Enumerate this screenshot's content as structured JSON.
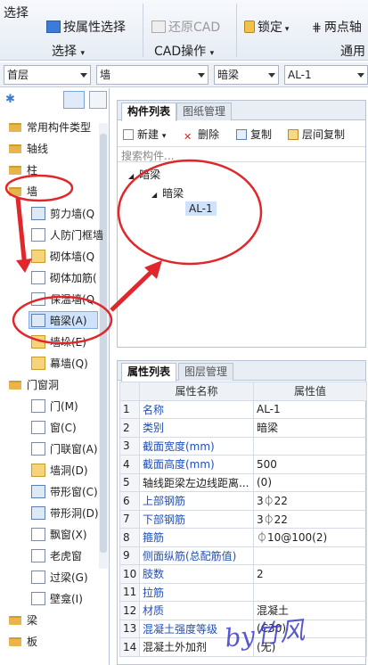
{
  "ribbon": {
    "select_label": "选择",
    "select_by_property": "按属性选择",
    "restore_cad": "还原CAD",
    "lock": "锁定",
    "two_point": "两点轴",
    "group_select": "选择",
    "group_cad": "CAD操作",
    "group_general": "通用"
  },
  "filters": {
    "floor": "首层",
    "element_type": "墙",
    "element_subtype": "暗梁",
    "element_name": "AL-1"
  },
  "tree": {
    "common": "常用构件类型",
    "axis": "轴线",
    "column": "柱",
    "wall": "墙",
    "wall_items": [
      "剪力墙(Q",
      "人防门框墙",
      "砌体墙(Q",
      "砌体加筋(",
      "保温墙(Q",
      "暗梁(A)",
      "墙垛(E)",
      "幕墙(Q)"
    ],
    "door_window": "门窗洞",
    "door_items": [
      "门(M)",
      "窗(C)",
      "门联窗(A)",
      "墙洞(D)",
      "带形窗(C)",
      "带形洞(D)",
      "飘窗(X)",
      "老虎窗",
      "过梁(G)",
      "壁龛(I)"
    ],
    "beam": "梁",
    "slab": "板"
  },
  "component_panel": {
    "tab_list": "构件列表",
    "tab_drawings": "图纸管理",
    "new": "新建",
    "delete": "删除",
    "copy": "复制",
    "floor_copy": "层间复制",
    "search_placeholder": "搜索构件...",
    "root": "暗梁",
    "child": "暗梁",
    "leaf": "AL-1"
  },
  "property_panel": {
    "tab_props": "属性列表",
    "tab_layers": "图层管理",
    "col_name": "属性名称",
    "col_value": "属性值",
    "rows": [
      {
        "n": "1",
        "name": "名称",
        "value": "AL-1",
        "blue": true
      },
      {
        "n": "2",
        "name": "类别",
        "value": "暗梁",
        "blue": true
      },
      {
        "n": "3",
        "name": "截面宽度(mm)",
        "value": "",
        "blue": true
      },
      {
        "n": "4",
        "name": "截面高度(mm)",
        "value": "500",
        "blue": true
      },
      {
        "n": "5",
        "name": "轴线距梁左边线距离...",
        "value": "(0)",
        "blue": false
      },
      {
        "n": "6",
        "name": "上部钢筋",
        "value": "3⏀22",
        "blue": true
      },
      {
        "n": "7",
        "name": "下部钢筋",
        "value": "3⏀22",
        "blue": true
      },
      {
        "n": "8",
        "name": "箍筋",
        "value": "⏀10@100(2)",
        "blue": true
      },
      {
        "n": "9",
        "name": "侧面纵筋(总配筋值)",
        "value": "",
        "blue": true
      },
      {
        "n": "10",
        "name": "肢数",
        "value": "2",
        "blue": true
      },
      {
        "n": "11",
        "name": "拉筋",
        "value": "",
        "blue": true
      },
      {
        "n": "12",
        "name": "材质",
        "value": "混凝土",
        "blue": true
      },
      {
        "n": "13",
        "name": "混凝土强度等级",
        "value": "(C30)",
        "blue": true
      },
      {
        "n": "14",
        "name": "混凝土外加剂",
        "value": "(无)",
        "blue": false
      }
    ]
  },
  "watermark": "by竹风",
  "colors": {
    "annotation": "#e0282c",
    "link_blue": "#1f4fb8"
  }
}
